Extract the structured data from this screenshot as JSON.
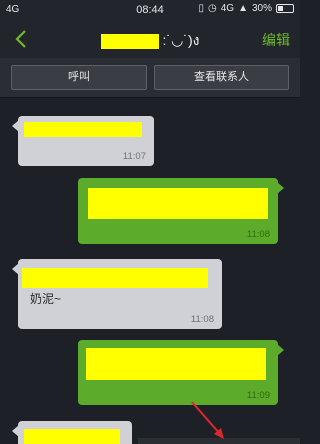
{
  "status_bar": {
    "signal_left": "4G",
    "time": "08:44",
    "network": "4G",
    "battery": "30%"
  },
  "header": {
    "title_suffix": ":˙◡˙)ง",
    "edit_label": "编辑"
  },
  "actions": {
    "call_label": "呼叫",
    "view_contact_label": "查看联系人"
  },
  "messages": [
    {
      "direction": "incoming",
      "time": "11:07"
    },
    {
      "direction": "outgoing",
      "time": "11:08"
    },
    {
      "direction": "incoming",
      "time": "11:08",
      "text_fragment": "奶泥~"
    },
    {
      "direction": "outgoing",
      "time": "11:09"
    },
    {
      "direction": "incoming",
      "time": ""
    }
  ],
  "colors": {
    "background": "#1e2027",
    "incoming_bubble": "#cfd1d6",
    "outgoing_bubble": "#5cab2a",
    "accent": "#6fb92b",
    "redaction": "#ffff00",
    "annotation_arrow": "#e0282a"
  }
}
